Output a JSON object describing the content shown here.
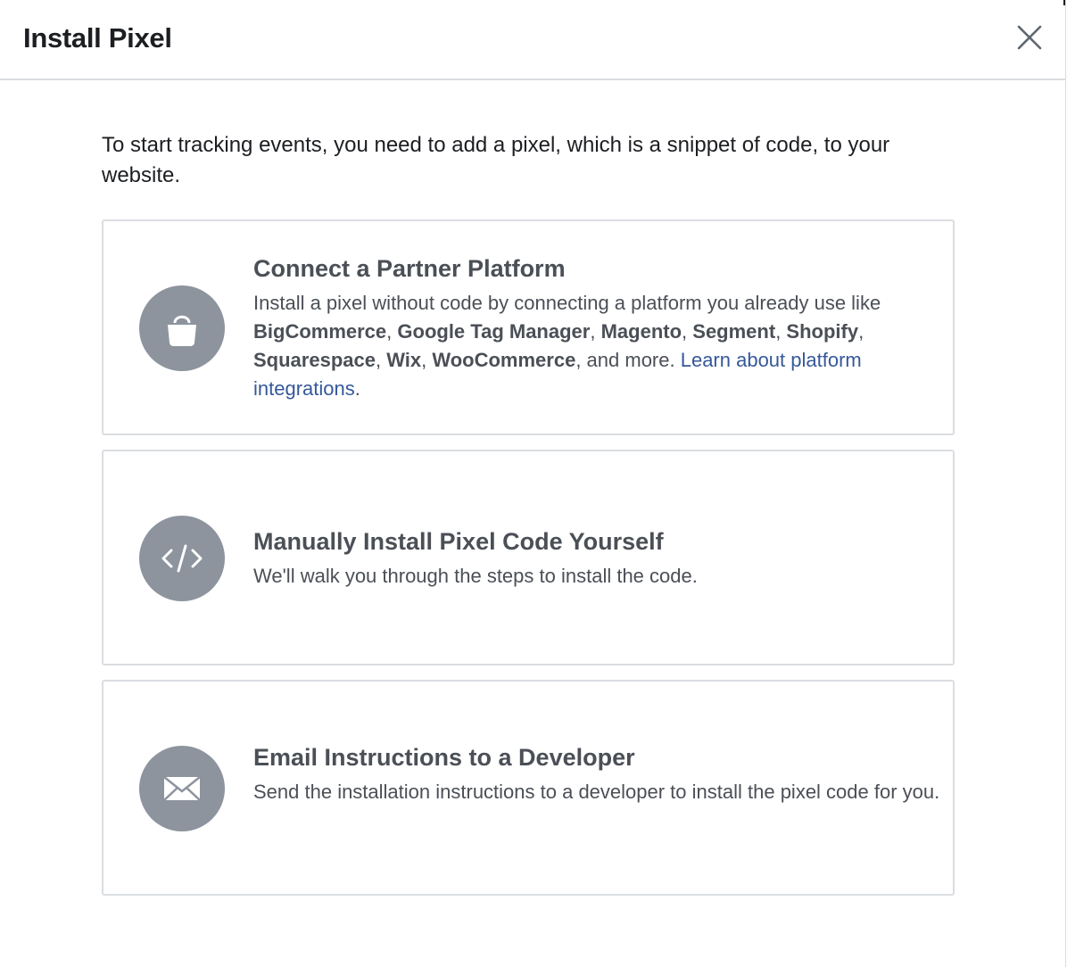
{
  "dialog": {
    "title": "Install Pixel",
    "close_icon": "close-icon",
    "intro": "To start tracking events, you need to add a pixel, which is a snippet of code, to your website."
  },
  "options": [
    {
      "title": "Connect a Partner Platform",
      "icon": "shopping-bag-icon",
      "desc_prefix": "Install a pixel without code by connecting a platform you already use like ",
      "platforms": [
        "BigCommerce",
        "Google Tag Manager",
        "Magento",
        "Segment",
        "Shopify",
        "Squarespace",
        "Wix",
        "WooCommerce"
      ],
      "separator": ", ",
      "desc_suffix": ", and more. ",
      "link_text": "Learn about platform integrations",
      "link_end": "."
    },
    {
      "title": "Manually Install Pixel Code Yourself",
      "icon": "code-icon",
      "desc": "We'll walk you through the steps to install the code."
    },
    {
      "title": "Email Instructions to a Developer",
      "icon": "envelope-icon",
      "desc": "Send the installation instructions to a developer to install the pixel code for you."
    }
  ],
  "colors": {
    "icon_bg": "#8d949e",
    "text": "#4b4f56",
    "link": "#365899",
    "border": "#dadde1"
  }
}
